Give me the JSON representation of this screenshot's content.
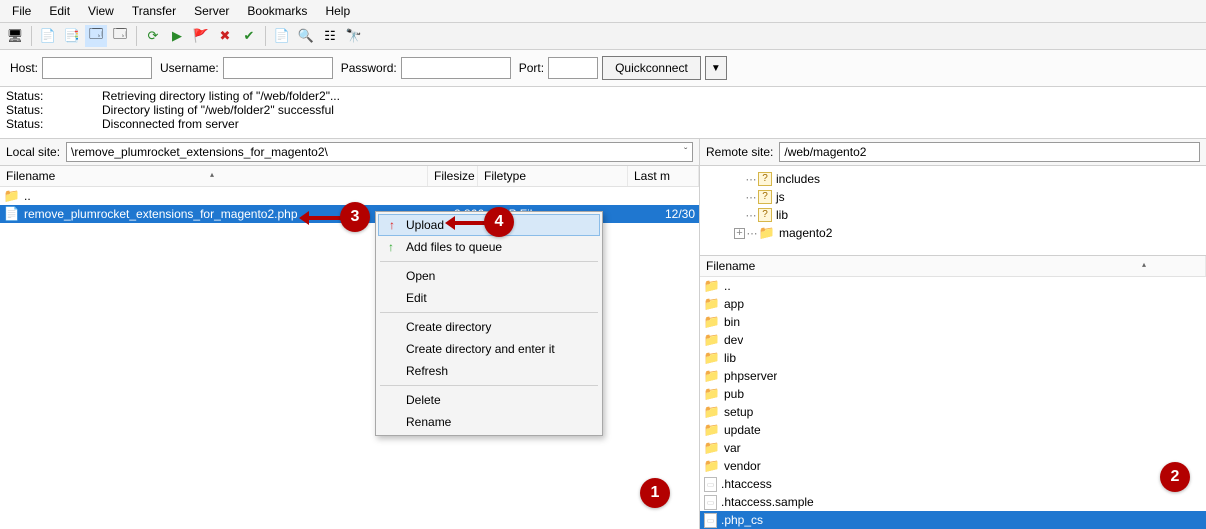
{
  "menu": [
    "File",
    "Edit",
    "View",
    "Transfer",
    "Server",
    "Bookmarks",
    "Help"
  ],
  "quickconnect": {
    "host_label": "Host:",
    "username_label": "Username:",
    "password_label": "Password:",
    "port_label": "Port:",
    "button": "Quickconnect"
  },
  "log": [
    {
      "label": "Status:",
      "text": "Retrieving directory listing of \"/web/folder2\"..."
    },
    {
      "label": "Status:",
      "text": "Directory listing of \"/web/folder2\" successful"
    },
    {
      "label": "Status:",
      "text": "Disconnected from server"
    }
  ],
  "local": {
    "site_label": "Local site:",
    "path": "\\remove_plumrocket_extensions_for_magento2\\",
    "columns": [
      "Filename",
      "Filesize",
      "Filetype",
      "Last m"
    ],
    "rows": [
      {
        "name": "..",
        "type": "updir"
      },
      {
        "name": "remove_plumrocket_extensions_for_magento2.php",
        "size": "2.866",
        "ftype": "PHP File",
        "mod": "12/30",
        "selected": true
      }
    ]
  },
  "remote": {
    "site_label": "Remote site:",
    "path": "/web/magento2",
    "tree": [
      {
        "name": "includes",
        "unknown": true,
        "indent": 1
      },
      {
        "name": "js",
        "unknown": true,
        "indent": 1
      },
      {
        "name": "lib",
        "unknown": true,
        "indent": 1
      },
      {
        "name": "magento2",
        "unknown": false,
        "indent": 1,
        "expandable": true
      }
    ],
    "columns": [
      "Filename"
    ],
    "rows": [
      {
        "name": "..",
        "type": "updir"
      },
      {
        "name": "app",
        "type": "folder"
      },
      {
        "name": "bin",
        "type": "folder"
      },
      {
        "name": "dev",
        "type": "folder"
      },
      {
        "name": "lib",
        "type": "folder"
      },
      {
        "name": "phpserver",
        "type": "folder"
      },
      {
        "name": "pub",
        "type": "folder"
      },
      {
        "name": "setup",
        "type": "folder"
      },
      {
        "name": "update",
        "type": "folder"
      },
      {
        "name": "var",
        "type": "folder"
      },
      {
        "name": "vendor",
        "type": "folder"
      },
      {
        "name": ".htaccess",
        "type": "file"
      },
      {
        "name": ".htaccess.sample",
        "type": "file"
      },
      {
        "name": ".php_cs",
        "type": "file",
        "selected": true
      }
    ]
  },
  "context_menu": [
    {
      "label": "Upload",
      "icon": "↑",
      "icon_color": "#d22",
      "highlight": true
    },
    {
      "label": "Add files to queue",
      "icon": "↑",
      "icon_color": "#3a3"
    },
    {
      "sep": true
    },
    {
      "label": "Open"
    },
    {
      "label": "Edit"
    },
    {
      "sep": true
    },
    {
      "label": "Create directory"
    },
    {
      "label": "Create directory and enter it"
    },
    {
      "label": "Refresh"
    },
    {
      "sep": true
    },
    {
      "label": "Delete"
    },
    {
      "label": "Rename"
    }
  ],
  "badges": {
    "b1": "1",
    "b2": "2",
    "b3": "3",
    "b4": "4"
  }
}
